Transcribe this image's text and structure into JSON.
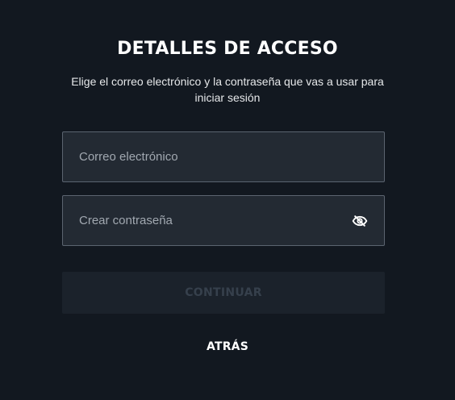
{
  "header": {
    "title": "DETALLES DE ACCESO",
    "subtitle": "Elige el correo electrónico y la contraseña que vas a usar para iniciar sesión"
  },
  "form": {
    "email": {
      "placeholder": "Correo electrónico",
      "value": ""
    },
    "password": {
      "placeholder": "Crear contraseña",
      "value": "",
      "visibility_icon": "eye-off-icon"
    },
    "continue_label": "CONTINUAR",
    "back_label": "ATRÁS"
  },
  "colors": {
    "background": "#121820",
    "field_background": "#232a33",
    "field_border": "#5b6470",
    "disabled_button_background": "#1b222b",
    "disabled_button_text": "#36404c",
    "text_primary": "#ffffff"
  }
}
